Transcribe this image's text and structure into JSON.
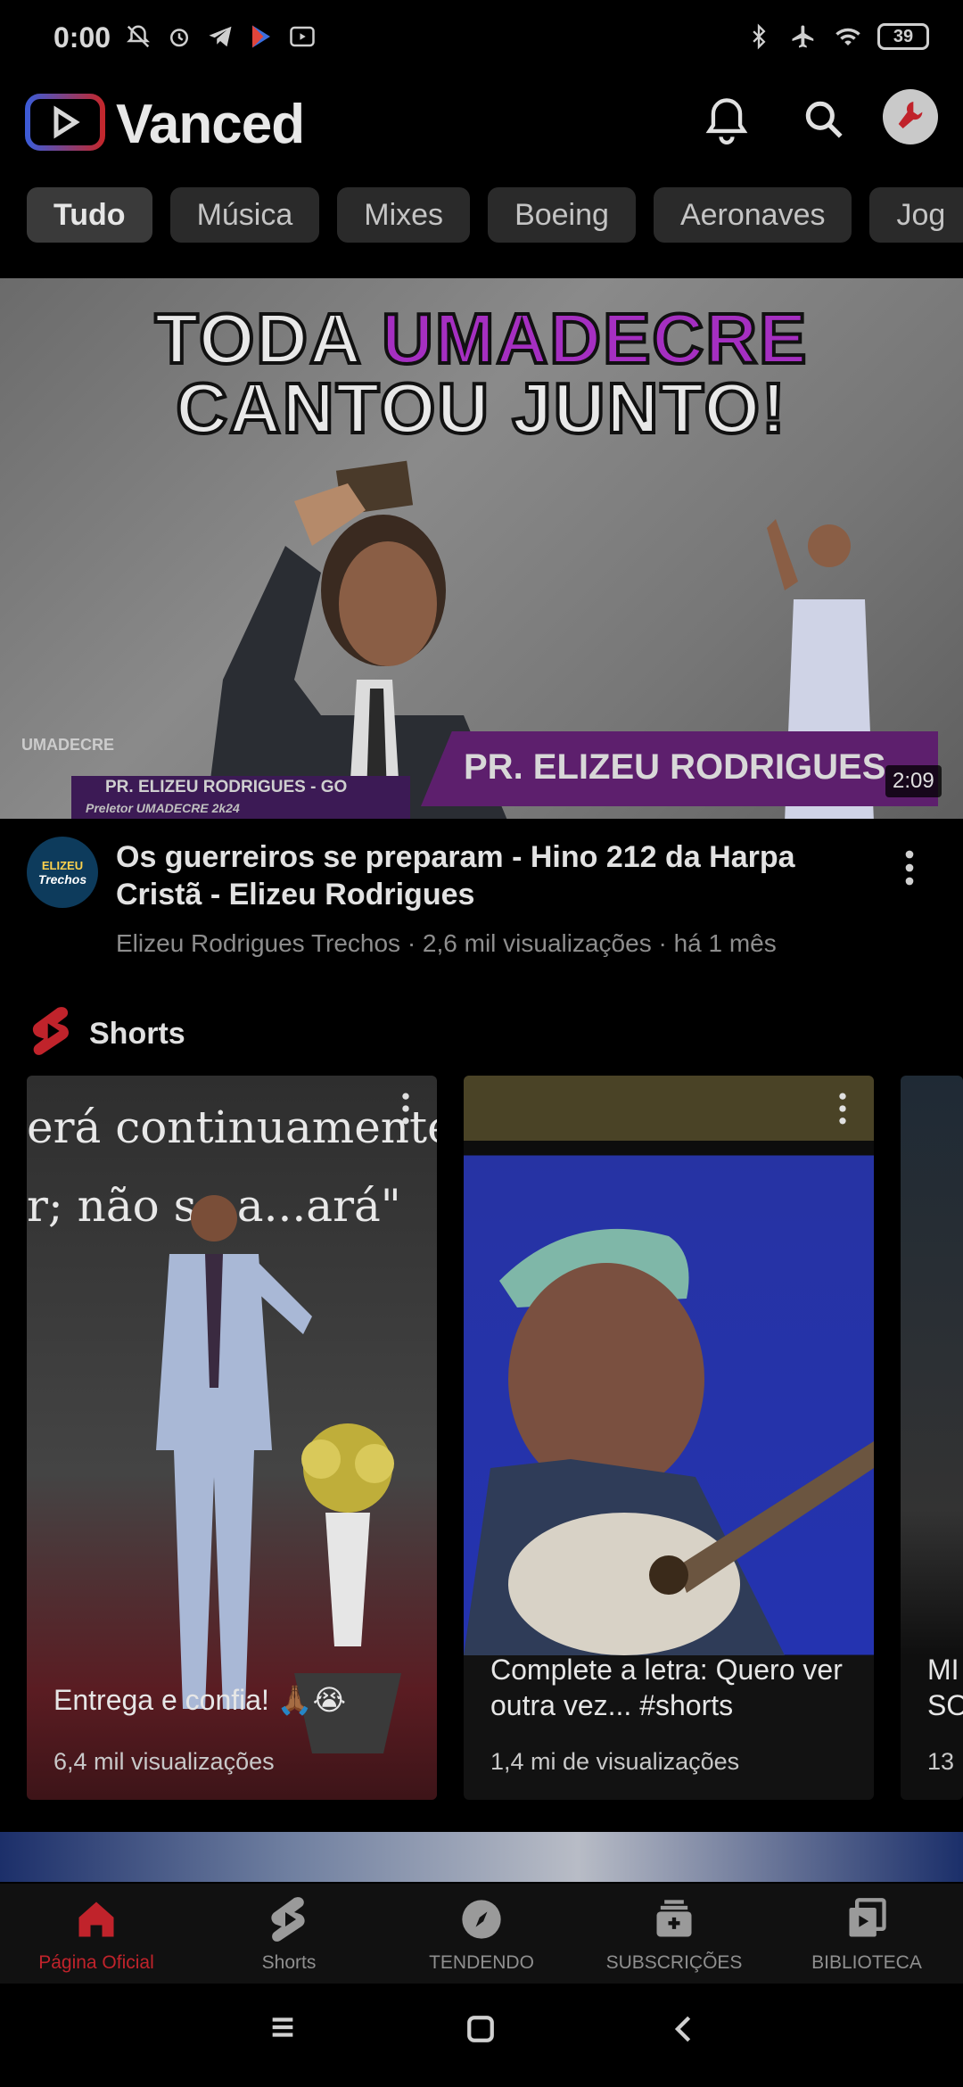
{
  "status_bar": {
    "time": "0:00",
    "battery": "39"
  },
  "header": {
    "app_name": "Vanced"
  },
  "chips": [
    "Tudo",
    "Música",
    "Mixes",
    "Boeing",
    "Aeronaves",
    "Jog"
  ],
  "hero": {
    "line1_a": "TODA ",
    "line1_b": "UMADECRE",
    "line2": "CANTOU JUNTO!",
    "banner_name": "PR. ELIZEU RODRIGUES",
    "lower_third_1": "PR. ELIZEU RODRIGUES - GO",
    "lower_third_2": "Preletor UMADECRE 2k24",
    "side_logo": "UMADECRE",
    "duration": "2:09"
  },
  "video": {
    "channel_avatar_line1": "ELIZEU",
    "channel_avatar_line2": "Trechos",
    "title": "Os guerreiros se preparam - Hino 212 da Harpa Cristã - Elizeu Rodrigues",
    "meta": "Elizeu Rodrigues Trechos · 2,6 mil visualizações · há 1 mês"
  },
  "shorts": {
    "heading": "Shorts",
    "items": [
      {
        "caption": "Entrega e confia! 🙏🏾😭",
        "views": "6,4 mil visualizações",
        "overlay_text": "erá continuamente\nr; não se a...ará\""
      },
      {
        "caption": "Complete a letra: Quero ver outra vez... #shorts",
        "views": "1,4 mi de visualizações"
      },
      {
        "caption": "MI SO",
        "views": "13"
      }
    ]
  },
  "bottom_nav": [
    {
      "label": "Página Oficial"
    },
    {
      "label": "Shorts"
    },
    {
      "label": "TENDENDO"
    },
    {
      "label": "SUBSCRIÇÕES"
    },
    {
      "label": "BIBLIOTECA"
    }
  ],
  "colors": {
    "accent": "#c0232b",
    "chip_bg": "#2a2a2a",
    "purple": "#a52fc1"
  }
}
